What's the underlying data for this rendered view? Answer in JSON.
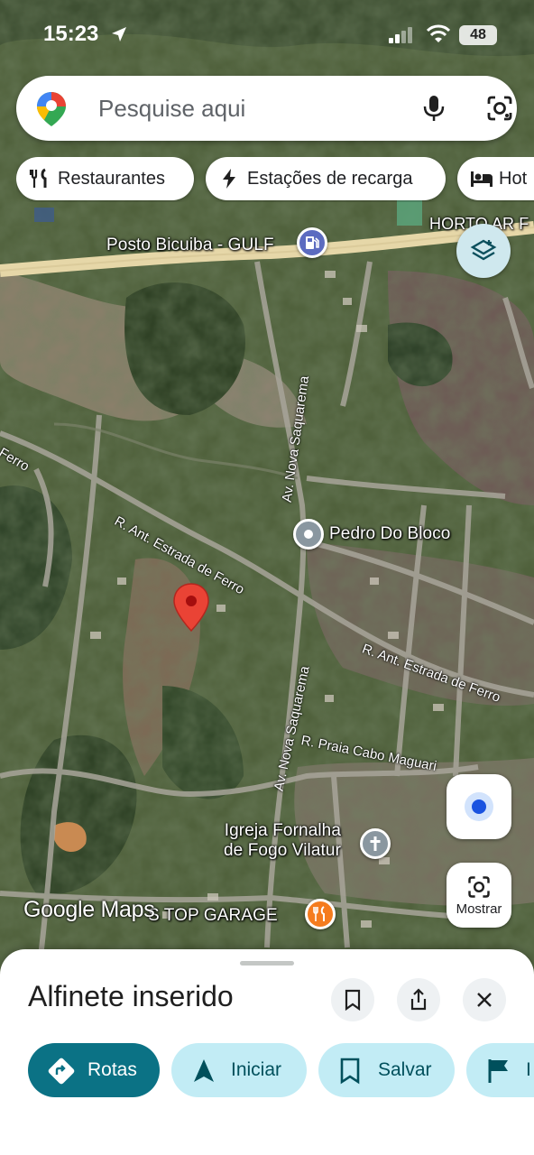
{
  "status_bar": {
    "time": "15:23",
    "battery": "48"
  },
  "search": {
    "placeholder": "Pesquise aqui"
  },
  "chips": [
    {
      "label": "Restaurantes",
      "icon": "fork-knife-icon"
    },
    {
      "label": "Estações de recarga",
      "icon": "bolt-icon"
    },
    {
      "label": "Hot",
      "icon": "bed-icon"
    }
  ],
  "map": {
    "places": {
      "gas_station": "Posto Bicuiba - GULF",
      "horto": "HORTO AR F",
      "pedro": "Pedro Do Bloco",
      "church_line1": "Igreja Fornalha",
      "church_line2": "de Fogo Vilatur",
      "garage": "S TOP GARAGE"
    },
    "streets": {
      "ferro_left": "Ferro",
      "ant_estrada_1": "R. Ant. Estrada de Ferro",
      "ant_estrada_2": "R. Ant. Estrada de Ferro",
      "nova_saquarema_1": "Av. Nova Saquarema",
      "nova_saquarema_2": "Av. Nova Saquarema",
      "praia_cabo": "R. Praia Cabo Maguari"
    },
    "attribution": "Google Maps",
    "show_button": "Mostrar",
    "colors": {
      "pin": "#ea4335",
      "gas": "#5c6bc0",
      "restaurant": "#f57c1f",
      "place": "#8a97a0"
    }
  },
  "sheet": {
    "title": "Alfinete inserido",
    "actions": [
      {
        "label": "Rotas",
        "icon": "directions-icon"
      },
      {
        "label": "Iniciar",
        "icon": "navigation-arrow-icon"
      },
      {
        "label": "Salvar",
        "icon": "bookmark-icon"
      },
      {
        "label": "I",
        "icon": "flag-icon"
      }
    ]
  }
}
